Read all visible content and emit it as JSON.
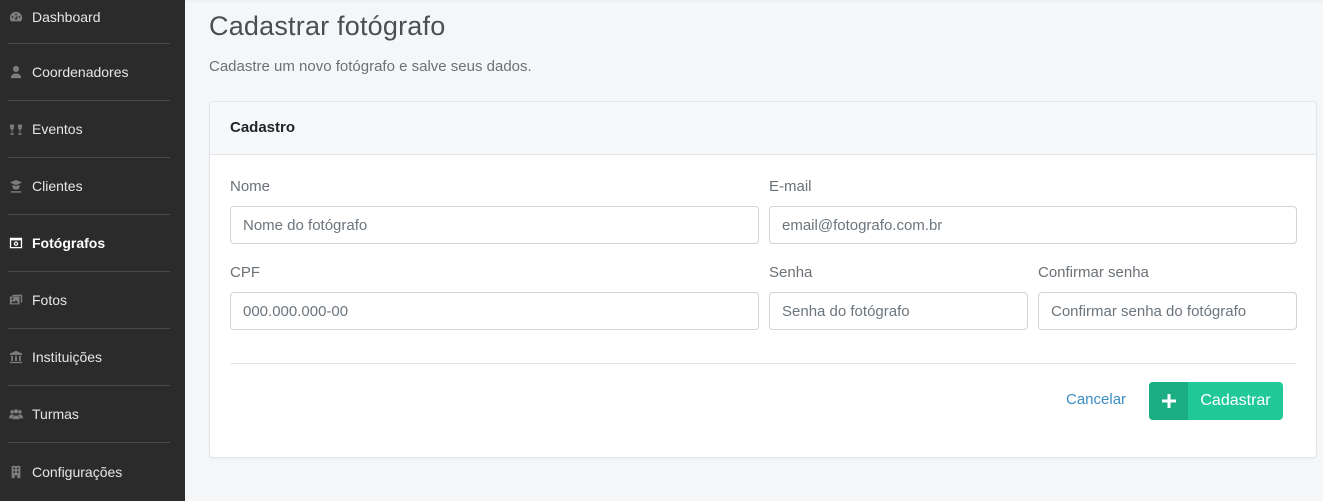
{
  "sidebar": {
    "items": [
      {
        "label": "Dashboard",
        "icon": "dashboard-icon",
        "active": false
      },
      {
        "label": "Coordenadores",
        "icon": "user-tie-icon",
        "active": false
      },
      {
        "label": "Eventos",
        "icon": "glasses-cheers-icon",
        "active": false
      },
      {
        "label": "Clientes",
        "icon": "graduate-icon",
        "active": false
      },
      {
        "label": "Fotógrafos",
        "icon": "camera-icon",
        "active": true
      },
      {
        "label": "Fotos",
        "icon": "images-icon",
        "active": false
      },
      {
        "label": "Instituições",
        "icon": "university-icon",
        "active": false
      },
      {
        "label": "Turmas",
        "icon": "users-icon",
        "active": false
      },
      {
        "label": "Configurações",
        "icon": "building-icon",
        "active": false
      }
    ]
  },
  "page": {
    "title": "Cadastrar fotógrafo",
    "subtitle": "Cadastre um novo fotógrafo e salve seus dados."
  },
  "card": {
    "header": "Cadastro",
    "fields": {
      "nome": {
        "label": "Nome",
        "placeholder": "Nome do fotógrafo",
        "value": ""
      },
      "email": {
        "label": "E-mail",
        "placeholder": "email@fotografo.com.br",
        "value": ""
      },
      "cpf": {
        "label": "CPF",
        "placeholder": "000.000.000-00",
        "value": ""
      },
      "senha": {
        "label": "Senha",
        "placeholder": "Senha do fotógrafo",
        "value": ""
      },
      "confirmar": {
        "label": "Confirmar senha",
        "placeholder": "Confirmar senha do fotógrafo",
        "value": ""
      }
    },
    "actions": {
      "cancel_label": "Cancelar",
      "submit_label": "Cadastrar"
    }
  },
  "colors": {
    "sidebar_bg": "#2b2b2b",
    "accent_green": "#20c997",
    "link_blue": "#3a8dc5"
  }
}
